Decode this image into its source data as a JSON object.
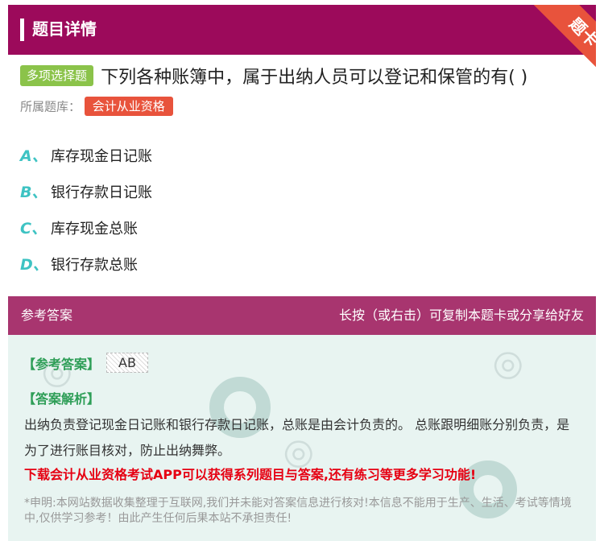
{
  "header": {
    "title": "题目详情",
    "ribbon": "题卡"
  },
  "question": {
    "type": "多项选择题",
    "text": "下列各种账簿中，属于出纳人员可以登记和保管的有( )",
    "bank_label": "所属题库：",
    "bank": "会计从业资格"
  },
  "options": [
    {
      "letter": "A、",
      "text": "库存现金日记账"
    },
    {
      "letter": "B、",
      "text": "银行存款日记账"
    },
    {
      "letter": "C、",
      "text": "库存现金总账"
    },
    {
      "letter": "D、",
      "text": "银行存款总账"
    }
  ],
  "answer_section": {
    "title": "参考答案",
    "hint": "长按（或右击）可复制本题卡或分享给好友",
    "ref_label": "【参考答案】",
    "ref_value": "AB",
    "analysis_label": "【答案解析】",
    "analysis": "出纳负责登记现金日记账和银行存款日记账，总账是由会计负责的。 总账跟明细账分别负责，是为了进行账目核对，防止出纳舞弊。",
    "promo": "下载会计从业资格考试APP可以获得系列题目与答案,还有练习等更多学习功能!",
    "disclaimer": "*申明:本网站数据收集整理于互联网,我们并未能对答案信息进行核对!本信息不能用于生产、生活、考试等情境中,仅供学习参考！由此产生任何后果本站不承担责任!"
  },
  "colors": {
    "header_bg": "#9c0a5b",
    "ribbon": "#e8533c",
    "qtype_badge": "#8bc34a",
    "bank_tag": "#e8533c",
    "option_letter": "#3ec3c3",
    "answer_header_bg": "#a8356f",
    "answer_body_bg": "#e8f4f1",
    "label_green": "#2e9e57",
    "promo_red": "#e60012"
  }
}
